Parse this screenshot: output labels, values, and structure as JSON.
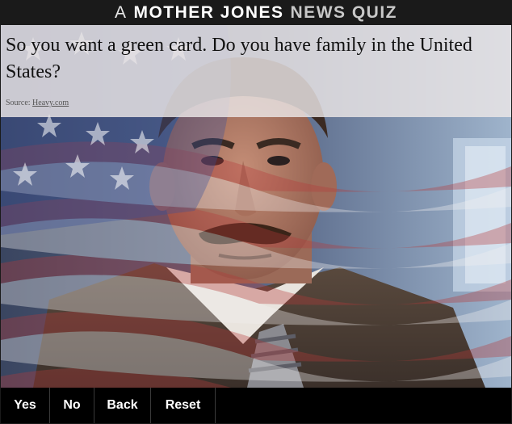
{
  "header": {
    "word1": "A",
    "word2": "MOTHER JONES",
    "word3": "NEWS QUIZ"
  },
  "question": {
    "text": "So you want a green card. Do you have family in the United States?",
    "source_label": "Source:",
    "source_link": "Heavy.com"
  },
  "image": {
    "description_icon": "man-with-flag-overlay-image"
  },
  "buttons": {
    "yes": "Yes",
    "no": "No",
    "back": "Back",
    "reset": "Reset"
  },
  "colors": {
    "header_bg": "#1a1a1a",
    "button_bar_bg": "#000000",
    "button_text": "#ffffff",
    "overlay_panel": "#ece6e6"
  }
}
